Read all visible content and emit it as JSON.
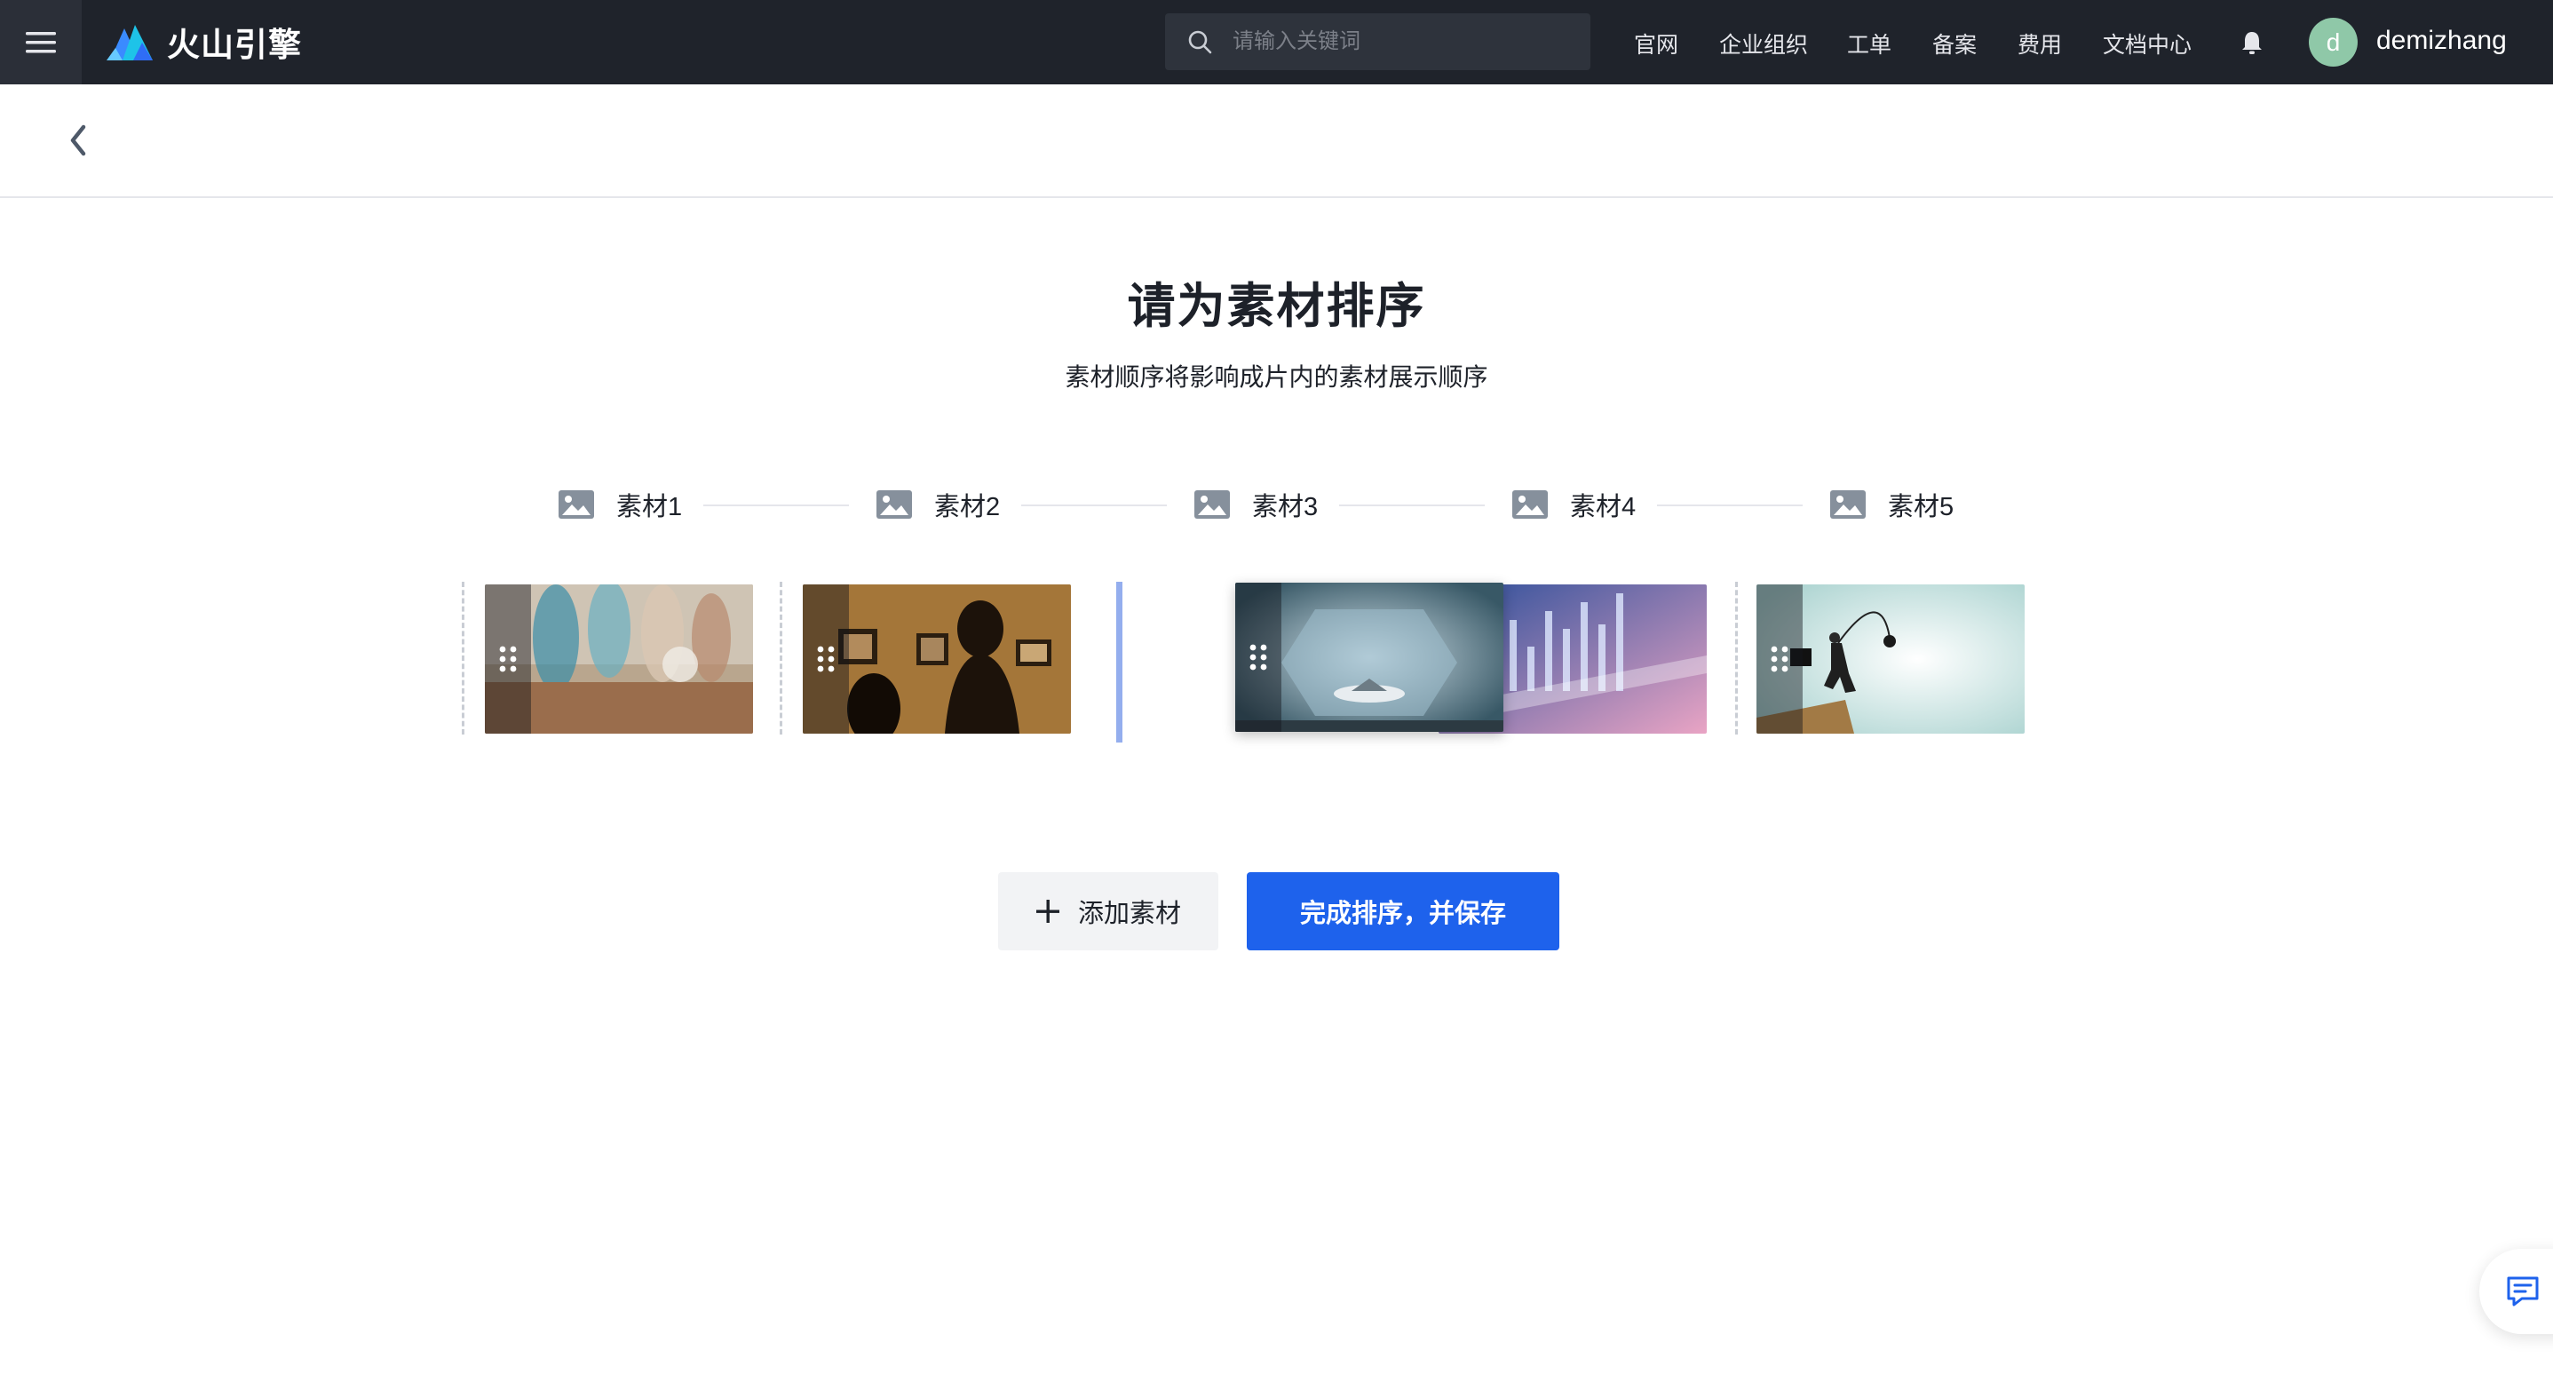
{
  "header": {
    "brand": "火山引擎",
    "search_placeholder": "请输入关键词",
    "nav": [
      "官网",
      "企业组织",
      "工单",
      "备案",
      "费用",
      "文档中心"
    ],
    "user": {
      "avatar_letter": "d",
      "name": "demizhang"
    }
  },
  "main": {
    "title": "请为素材排序",
    "subtitle": "素材顺序将影响成片内的素材展示顺序",
    "steps": [
      "素材1",
      "素材2",
      "素材3",
      "素材4",
      "素材5"
    ],
    "actions": {
      "add_label": "添加素材",
      "save_label": "完成排序，并保存"
    }
  },
  "colors": {
    "topbar": "#1f232b",
    "primary": "#1e62ec",
    "drop_indicator": "#94aeee"
  },
  "icons": [
    "menu-icon",
    "volcano-logo-icon",
    "search-icon",
    "bell-icon",
    "back-chevron-icon",
    "image-icon",
    "drag-handle-icon",
    "plus-icon",
    "feedback-icon"
  ]
}
